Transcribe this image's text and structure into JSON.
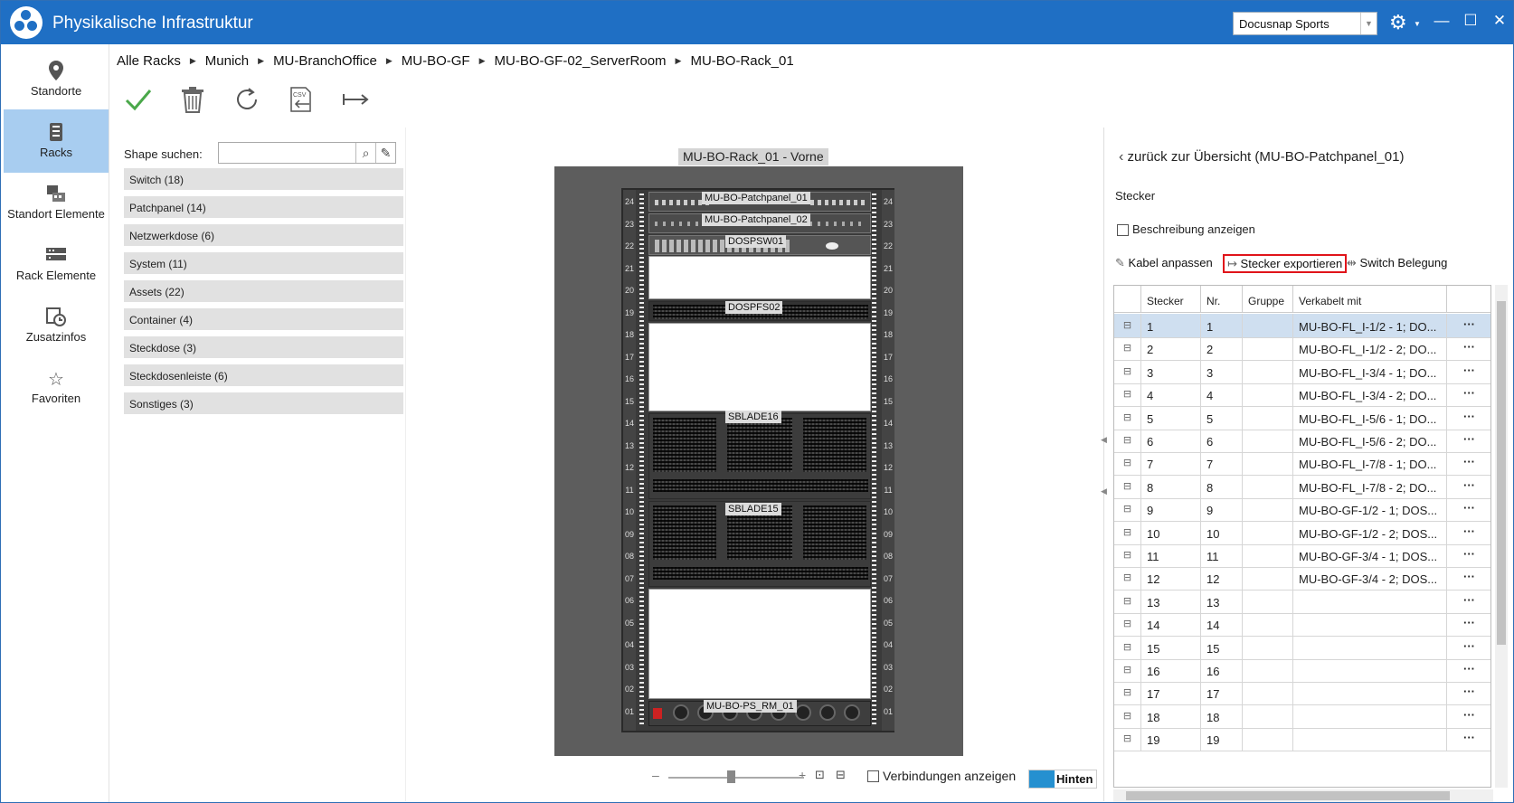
{
  "titlebar": {
    "title": "Physikalische Infrastruktur",
    "workspace_select": "Docusnap Sports",
    "accent": "#1f6fc4"
  },
  "nav": {
    "items": [
      {
        "label": "Standorte",
        "icon": "location-pin-icon"
      },
      {
        "label": "Racks",
        "icon": "rack-icon",
        "active": true
      },
      {
        "label": "Standort Elemente",
        "icon": "site-elements-icon"
      },
      {
        "label": "Rack Elemente",
        "icon": "rack-elements-icon"
      },
      {
        "label": "Zusatzinfos",
        "icon": "additional-info-icon"
      },
      {
        "label": "Favoriten",
        "icon": "star-icon"
      }
    ]
  },
  "breadcrumb": [
    "Alle Racks",
    "Munich",
    "MU-BranchOffice",
    "MU-BO-GF",
    "MU-BO-GF-02_ServerRoom",
    "MU-BO-Rack_01"
  ],
  "toolbar": {
    "icons": [
      "checkmark-icon",
      "trash-icon",
      "refresh-icon",
      "csv-import-icon",
      "export-arrow-icon"
    ]
  },
  "shapes": {
    "search_label": "Shape suchen:",
    "search_value": "",
    "categories": [
      "Switch (18)",
      "Patchpanel (14)",
      "Netzwerkdose (6)",
      "System (11)",
      "Assets (22)",
      "Container (4)",
      "Steckdose (3)",
      "Steckdosenleiste (6)",
      "Sonstiges (3)"
    ]
  },
  "rack": {
    "title": "MU-BO-Rack_01 - Vorne",
    "units": [
      "24",
      "23",
      "22",
      "21",
      "20",
      "19",
      "18",
      "17",
      "16",
      "15",
      "14",
      "13",
      "12",
      "11",
      "10",
      "09",
      "08",
      "07",
      "06",
      "05",
      "04",
      "03",
      "02",
      "01"
    ],
    "devices": [
      "MU-BO-Patchpanel_01",
      "MU-BO-Patchpanel_02",
      "DOSPSW01",
      "DOSPFS02",
      "SBLADE16",
      "SBLADE15",
      "MU-BO-PS_RM_01"
    ]
  },
  "bottom": {
    "zoom_minus": "–",
    "zoom_plus": "+",
    "connections_label": "Verbindungen anzeigen",
    "view_toggle": "Hinten"
  },
  "right_panel": {
    "back_link": "zurück zur Übersicht (MU-BO-Patchpanel_01)",
    "heading": "Stecker",
    "show_description": "Beschreibung anzeigen",
    "actions": {
      "adjust_cable": "Kabel anpassen",
      "export_plugs": "Stecker exportieren",
      "switch_assignment": "Switch Belegung"
    },
    "columns": [
      "Stecker",
      "Nr.",
      "Gruppe",
      "Verkabelt mit"
    ],
    "rows": [
      {
        "stecker": "1",
        "nr": "1",
        "gruppe": "",
        "verkabelt": "MU-BO-FL_I-1/2 - 1; DO..."
      },
      {
        "stecker": "2",
        "nr": "2",
        "gruppe": "",
        "verkabelt": "MU-BO-FL_I-1/2 - 2; DO..."
      },
      {
        "stecker": "3",
        "nr": "3",
        "gruppe": "",
        "verkabelt": "MU-BO-FL_I-3/4 - 1; DO..."
      },
      {
        "stecker": "4",
        "nr": "4",
        "gruppe": "",
        "verkabelt": "MU-BO-FL_I-3/4 - 2; DO..."
      },
      {
        "stecker": "5",
        "nr": "5",
        "gruppe": "",
        "verkabelt": "MU-BO-FL_I-5/6 - 1; DO..."
      },
      {
        "stecker": "6",
        "nr": "6",
        "gruppe": "",
        "verkabelt": "MU-BO-FL_I-5/6 - 2; DO..."
      },
      {
        "stecker": "7",
        "nr": "7",
        "gruppe": "",
        "verkabelt": "MU-BO-FL_I-7/8 - 1; DO..."
      },
      {
        "stecker": "8",
        "nr": "8",
        "gruppe": "",
        "verkabelt": "MU-BO-FL_I-7/8 - 2; DO..."
      },
      {
        "stecker": "9",
        "nr": "9",
        "gruppe": "",
        "verkabelt": "MU-BO-GF-1/2 - 1; DOS..."
      },
      {
        "stecker": "10",
        "nr": "10",
        "gruppe": "",
        "verkabelt": "MU-BO-GF-1/2 - 2; DOS..."
      },
      {
        "stecker": "11",
        "nr": "11",
        "gruppe": "",
        "verkabelt": "MU-BO-GF-3/4 - 1; DOS..."
      },
      {
        "stecker": "12",
        "nr": "12",
        "gruppe": "",
        "verkabelt": "MU-BO-GF-3/4 - 2; DOS..."
      },
      {
        "stecker": "13",
        "nr": "13",
        "gruppe": "",
        "verkabelt": ""
      },
      {
        "stecker": "14",
        "nr": "14",
        "gruppe": "",
        "verkabelt": ""
      },
      {
        "stecker": "15",
        "nr": "15",
        "gruppe": "",
        "verkabelt": ""
      },
      {
        "stecker": "16",
        "nr": "16",
        "gruppe": "",
        "verkabelt": ""
      },
      {
        "stecker": "17",
        "nr": "17",
        "gruppe": "",
        "verkabelt": ""
      },
      {
        "stecker": "18",
        "nr": "18",
        "gruppe": "",
        "verkabelt": ""
      },
      {
        "stecker": "19",
        "nr": "19",
        "gruppe": "",
        "verkabelt": ""
      }
    ],
    "row_menu": "···",
    "highlight_color": "#e0141a"
  }
}
